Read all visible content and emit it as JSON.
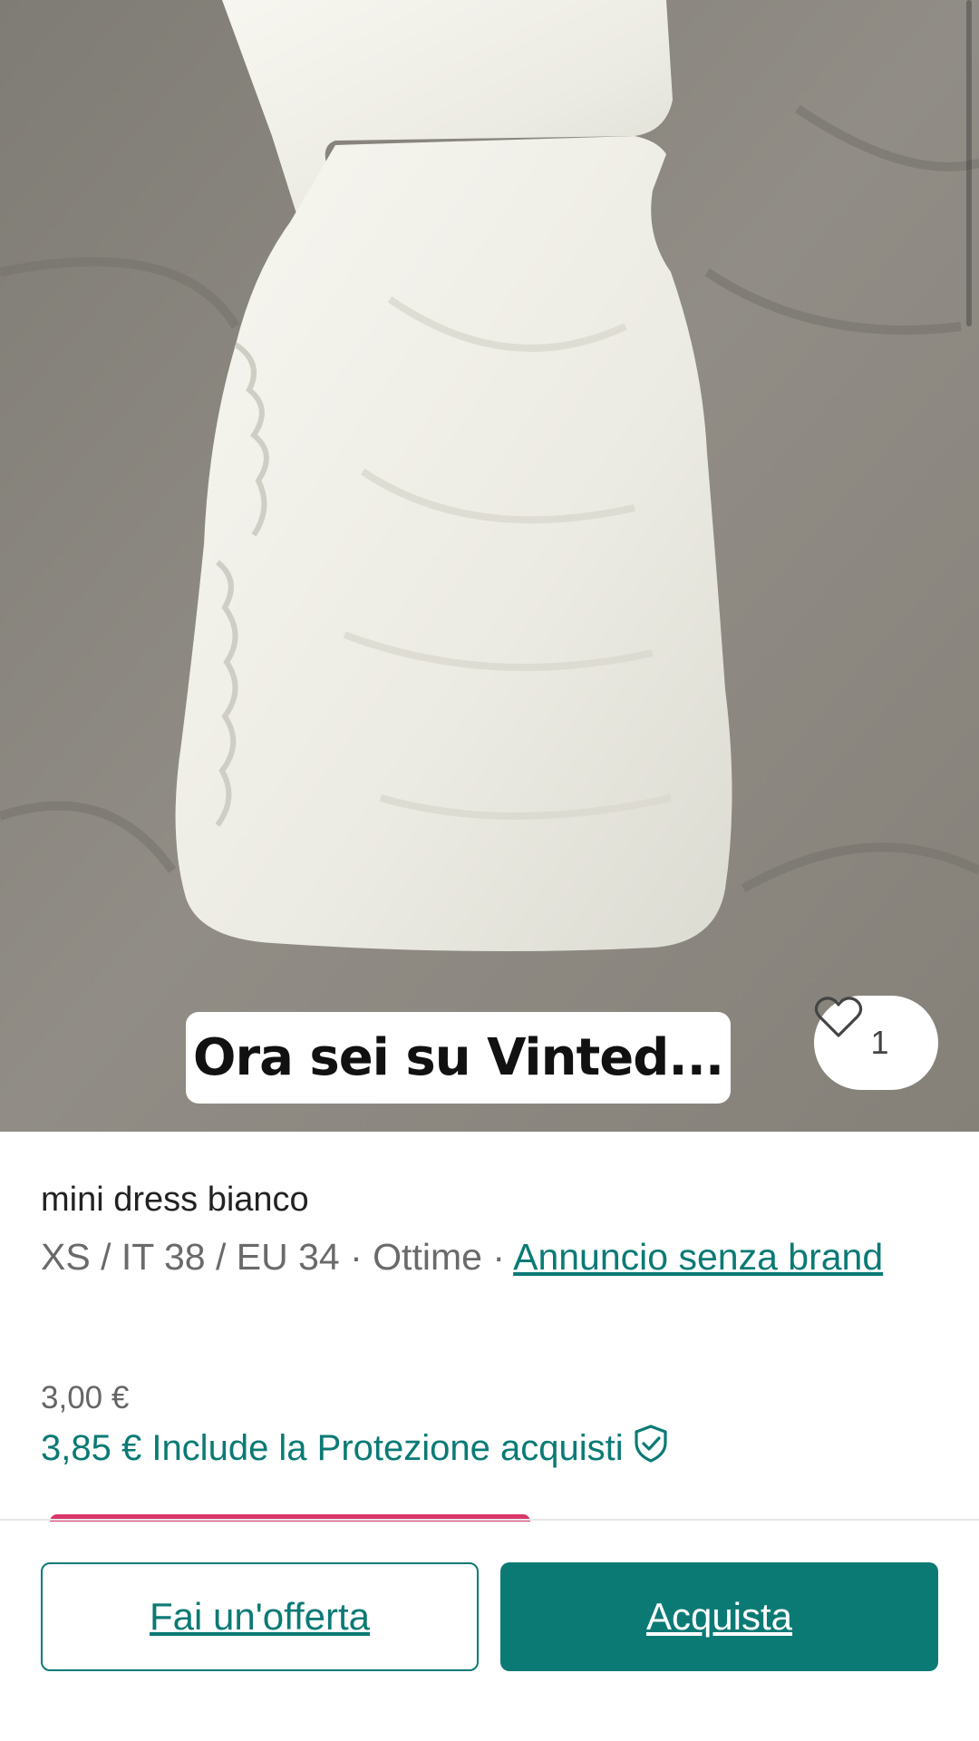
{
  "overlay": {
    "caption": "Ora sei su Vinted...",
    "favorite_count": "1"
  },
  "item": {
    "title": "mini dress bianco",
    "size": "XS / IT 38 / EU 34",
    "condition": "Ottime",
    "separator": "·",
    "brand_link": "Annuncio senza brand",
    "price": "3,00 €",
    "total_price_text": "3,85 € Include la Protezione acquisti"
  },
  "actions": {
    "offer_label": "Fai un'offerta",
    "buy_label": "Acquista"
  },
  "colors": {
    "accent": "#0b7a75",
    "photo_background": "#8a8780"
  },
  "icons": {
    "favorite": "heart-icon",
    "protection": "shield-check-icon"
  }
}
